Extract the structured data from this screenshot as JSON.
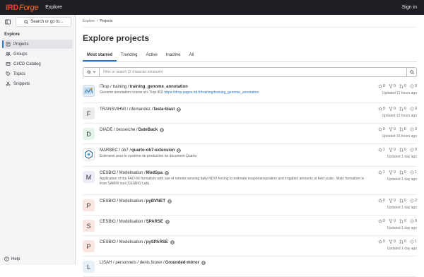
{
  "topbar": {
    "logo_prefix": "IRD",
    "logo_suffix": "Forge",
    "explore": "Explore",
    "signin": "Sign in"
  },
  "sidebar": {
    "search_label": "Search or go to...",
    "heading": "Explore",
    "items": [
      {
        "label": "Projects",
        "icon": "project-icon",
        "active": true
      },
      {
        "label": "Groups",
        "icon": "group-icon"
      },
      {
        "label": "CI/CD Catalog",
        "icon": "catalog-icon"
      },
      {
        "label": "Topics",
        "icon": "label-icon"
      },
      {
        "label": "Snippets",
        "icon": "snippet-icon"
      }
    ],
    "help": "Help"
  },
  "breadcrumb": {
    "root": "Explore",
    "current": "Projects"
  },
  "page_title": "Explore projects",
  "tabs": [
    "Most starred",
    "Trending",
    "Active",
    "Inactive",
    "All"
  ],
  "filter": {
    "placeholder": "Filter or search (3 character minimum)"
  },
  "projects": [
    {
      "avatar": "",
      "avatar_bg": "#e7f0f6",
      "namespace": "iTrop / training / ",
      "name": "training_genome_annotation",
      "public": false,
      "desc": "Genome annotation course at i-Trop IRD ",
      "link": "https://itrop.pages.ird.fr/training/training_genome_annotation",
      "stars": "0",
      "forks": "0",
      "mrs": "0",
      "issues": "0",
      "updated": "Updated 11 hours ago"
    },
    {
      "avatar": "F",
      "avatar_bg": "#ececef",
      "namespace": "TRANSVIHMI / nfernandez / ",
      "name": "fasta-blast",
      "public": true,
      "desc": "",
      "link": "",
      "stars": "0",
      "forks": "0",
      "mrs": "0",
      "issues": "0",
      "updated": "Updated 12 hours ago"
    },
    {
      "avatar": "D",
      "avatar_bg": "#e3f4e8",
      "namespace": "DIADE / besseiche / ",
      "name": "DateBack",
      "public": true,
      "desc": "",
      "link": "",
      "stars": "0",
      "forks": "0",
      "mrs": "0",
      "issues": "0",
      "updated": "Updated 16 hours ago"
    },
    {
      "avatar": "",
      "avatar_bg": "#ffffff",
      "namespace": "MARBEC / ob7 / ",
      "name": "quarto-ob7-extension",
      "public": true,
      "desc": "Extension pour le système de production de document Quarto",
      "link": "",
      "stars": "1",
      "forks": "0",
      "mrs": "0",
      "issues": "0",
      "updated": "Updated 1 day ago"
    },
    {
      "avatar": "M",
      "avatar_bg": "#ececf8",
      "namespace": "CESBIO / Modélisation / ",
      "name": "ModSpa",
      "public": true,
      "desc": "Application of the FAO-56 formalism with use of remote-sensing daily NDVI forcing to estimate evapotranspiration and irrigation amounts at field scale . Main formalism is from SAMIR tool (CESBIO Lab).",
      "link": "",
      "stars": "1",
      "forks": "0",
      "mrs": "0",
      "issues": "1",
      "updated": "Updated 1 day ago"
    },
    {
      "avatar": "P",
      "avatar_bg": "#fbe5e1",
      "namespace": "CESBIO / Modélisation / ",
      "name": "pyBVNET",
      "public": true,
      "desc": "",
      "link": "",
      "stars": "0",
      "forks": "0",
      "mrs": "0",
      "issues": "2",
      "updated": "Updated 1 day ago"
    },
    {
      "avatar": "S",
      "avatar_bg": "#fbe5e1",
      "namespace": "CESBIO / Modélisation / ",
      "name": "SPARSE",
      "public": true,
      "desc": "",
      "link": "",
      "stars": "0",
      "forks": "0",
      "mrs": "0",
      "issues": "0",
      "updated": "Updated 1 day ago"
    },
    {
      "avatar": "P",
      "avatar_bg": "#fbe5e1",
      "namespace": "CESBIO / Modélisation / ",
      "name": "pySPARSE",
      "public": true,
      "desc": "",
      "link": "",
      "stars": "0",
      "forks": "0",
      "mrs": "0",
      "issues": "1",
      "updated": "Updated 1 day ago"
    },
    {
      "avatar": "L",
      "avatar_bg": "#e7f0f6",
      "namespace": "LISAH / personnels / denis.feurer / ",
      "name": "Grounded-mirror",
      "public": true,
      "desc": "",
      "link": "",
      "stars": "",
      "forks": "",
      "mrs": "",
      "issues": "",
      "updated": ""
    }
  ]
}
